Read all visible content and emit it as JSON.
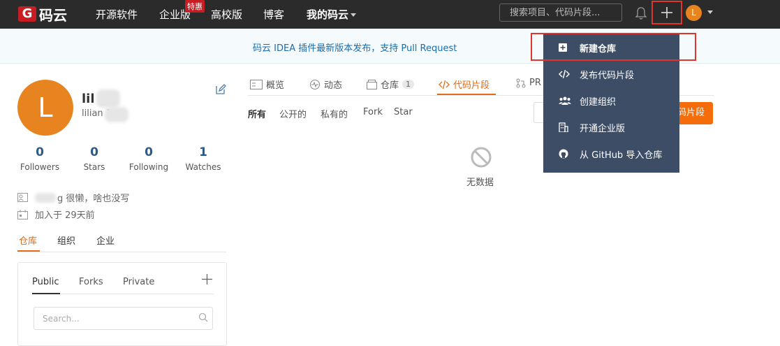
{
  "header": {
    "logo_text": "码云",
    "nav": [
      "开源软件",
      "企业版",
      "高校版",
      "博客",
      "我的码云"
    ],
    "hot_badge": "特惠",
    "search_placeholder": "搜索项目、代码片段..."
  },
  "announcement": "码云 IDEA 插件最新版本发布，支持 Pull Request",
  "profile": {
    "avatar_letter": "L",
    "name": "lil  g",
    "id": "lilian   1",
    "stats": [
      {
        "value": "0",
        "label": "Followers"
      },
      {
        "value": "0",
        "label": "Stars"
      },
      {
        "value": "0",
        "label": "Following"
      },
      {
        "value": "1",
        "label": "Watches"
      }
    ],
    "bio": "g 很懒，啥也没写",
    "joined": "加入于 29天前",
    "tabs": [
      "仓库",
      "组织",
      "企业"
    ]
  },
  "repo_card": {
    "tabs": [
      "Public",
      "Forks",
      "Private"
    ],
    "search_placeholder": "Search..."
  },
  "main": {
    "tabs": [
      "概览",
      "动态",
      "仓库",
      "代码片段",
      "PR"
    ],
    "repo_count": "1",
    "filters": [
      "所有",
      "公开的",
      "私有的",
      "Fork",
      "Star"
    ],
    "action_button": "码片段",
    "empty_text": "无数据"
  },
  "dropdown": {
    "items": [
      "新建仓库",
      "发布代码片段",
      "创建组织",
      "开通企业版",
      "从 GitHub 导入仓库"
    ]
  },
  "colors": {
    "header_bg": "#2b2b2b",
    "accent": "#e06c1c",
    "brand_red": "#c71d23",
    "dropdown_bg": "#3d4d66",
    "highlight": "#e0342c"
  }
}
